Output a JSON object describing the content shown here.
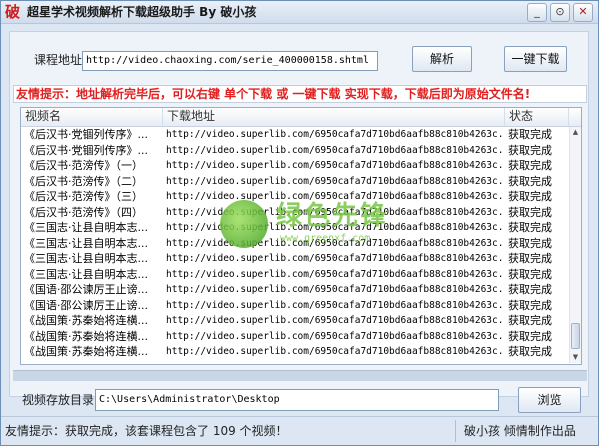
{
  "window": {
    "logo": "破",
    "title": "超星学术视频解析下载超级助手 By 破小孩",
    "buttons": {
      "minimize": "_",
      "settings": "⊙",
      "close": "✕"
    }
  },
  "url_row": {
    "label": "课程地址",
    "value": "http://video.chaoxing.com/serie_400000158.shtml",
    "parse_button": "解析",
    "download_all_button": "一键下载"
  },
  "notice": "友情提示：地址解析完毕后，可以右键 单个下载 或 一键下载 实现下载，下载后即为原始文件名!",
  "list": {
    "columns": [
      "视频名",
      "下载地址",
      "状态"
    ],
    "rows": [
      {
        "name": "《后汉书·党锢列传序》...",
        "url": "http://video.superlib.com/6950cafa7d710bd6aafb88c810b4263c...",
        "status": "获取完成"
      },
      {
        "name": "《后汉书·党锢列传序》...",
        "url": "http://video.superlib.com/6950cafa7d710bd6aafb88c810b4263c...",
        "status": "获取完成"
      },
      {
        "name": "《后汉书·范滂传》（一）",
        "url": "http://video.superlib.com/6950cafa7d710bd6aafb88c810b4263c...",
        "status": "获取完成"
      },
      {
        "name": "《后汉书·范滂传》（二）",
        "url": "http://video.superlib.com/6950cafa7d710bd6aafb88c810b4263c...",
        "status": "获取完成"
      },
      {
        "name": "《后汉书·范滂传》（三）",
        "url": "http://video.superlib.com/6950cafa7d710bd6aafb88c810b4263c...",
        "status": "获取完成"
      },
      {
        "name": "《后汉书·范滂传》（四）",
        "url": "http://video.superlib.com/6950cafa7d710bd6aafb88c810b4263c...",
        "status": "获取完成"
      },
      {
        "name": "《三国志·让县自明本志...",
        "url": "http://video.superlib.com/6950cafa7d710bd6aafb88c810b4263c...",
        "status": "获取完成"
      },
      {
        "name": "《三国志·让县自明本志...",
        "url": "http://video.superlib.com/6950cafa7d710bd6aafb88c810b4263c...",
        "status": "获取完成"
      },
      {
        "name": "《三国志·让县自明本志...",
        "url": "http://video.superlib.com/6950cafa7d710bd6aafb88c810b4263c...",
        "status": "获取完成"
      },
      {
        "name": "《三国志·让县自明本志...",
        "url": "http://video.superlib.com/6950cafa7d710bd6aafb88c810b4263c...",
        "status": "获取完成"
      },
      {
        "name": "《国语·邵公谏厉王止谤...",
        "url": "http://video.superlib.com/6950cafa7d710bd6aafb88c810b4263c...",
        "status": "获取完成"
      },
      {
        "name": "《国语·邵公谏厉王止谤...",
        "url": "http://video.superlib.com/6950cafa7d710bd6aafb88c810b4263c...",
        "status": "获取完成"
      },
      {
        "name": "《战国策·苏秦始将连横...",
        "url": "http://video.superlib.com/6950cafa7d710bd6aafb88c810b4263c...",
        "status": "获取完成"
      },
      {
        "name": "《战国策·苏秦始将连横...",
        "url": "http://video.superlib.com/6950cafa7d710bd6aafb88c810b4263c...",
        "status": "获取完成"
      },
      {
        "name": "《战国策·苏秦始将连横...",
        "url": "http://video.superlib.com/6950cafa7d710bd6aafb88c810b4263c...",
        "status": "获取完成"
      }
    ]
  },
  "watermark": {
    "text": "绿色先锋",
    "url": "www.greenxf.com"
  },
  "save_row": {
    "label": "视频存放目录",
    "value": "C:\\Users\\Administrator\\Desktop",
    "browse_button": "浏览"
  },
  "status_bar": {
    "left": "友情提示：获取完成，该套课程包含了 109 个视频！",
    "right": "破小孩 倾情制作出品"
  },
  "colors": {
    "notice_red": "#e02020",
    "title_logo_red": "#d21a1a",
    "window_bg": "#dce7f3"
  }
}
